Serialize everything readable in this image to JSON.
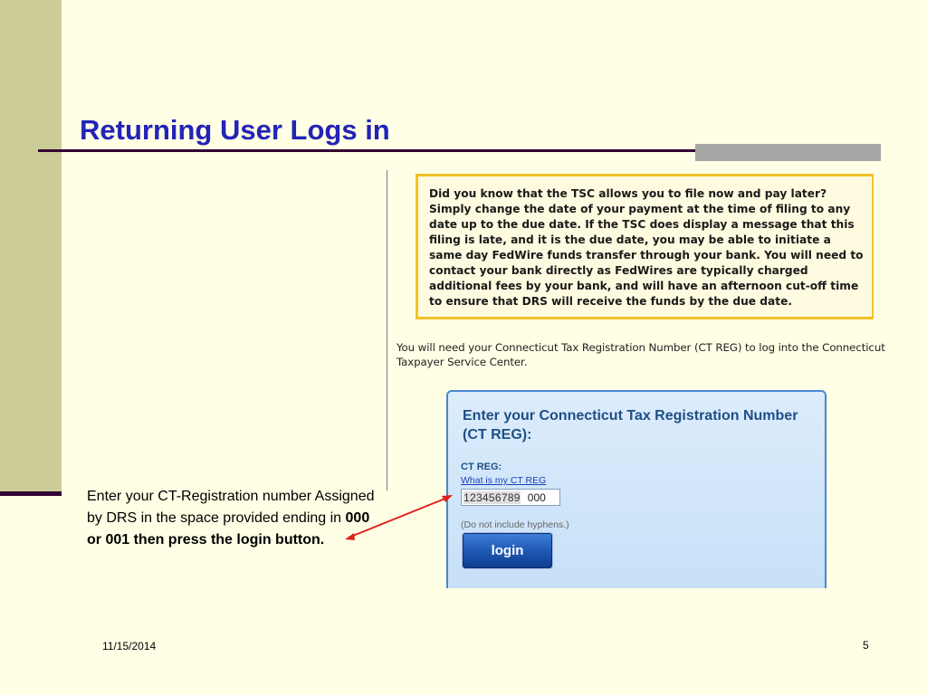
{
  "slide": {
    "title": "Returning User Logs in",
    "date": "11/15/2014",
    "page_number": "5"
  },
  "tip": {
    "text": "Did you know that the TSC allows you to file now and pay later? Simply change the date of your payment at the time of filing to any date up to the due date. If the TSC does display a message that this filing is late, and it is the due date, you may be able to initiate a same day FedWire funds transfer through your bank. You will need to contact your bank directly as FedWires are typically charged additional fees by your bank, and will have an afternoon cut-off time to ensure that DRS will receive the funds by the due date."
  },
  "intro": {
    "text": "You will need your Connecticut Tax Registration Number (CT REG) to log into the Connecticut Taxpayer Service Center."
  },
  "login_panel": {
    "heading": "Enter your Connecticut Tax Registration Number (CT REG):",
    "field_label": "CT REG:",
    "help_link": "What is my CT REG",
    "input_prefix": "123456789",
    "input_suffix": "000",
    "hyphen_note": "(Do not include hyphens.)",
    "login_label": "login"
  },
  "callout": {
    "text_plain": "Enter your CT-Registration number Assigned by DRS in the space provided ending in ",
    "text_bold": "000 or 001 then press the login button."
  },
  "colors": {
    "background": "#ffffe5",
    "left_band": "#cccc99",
    "title": "#2323b8",
    "rule": "#330033",
    "tip_border": "#f2c22a",
    "panel_border": "#4a86cf",
    "button": "#1f59b5",
    "arrow": "#e02020"
  }
}
